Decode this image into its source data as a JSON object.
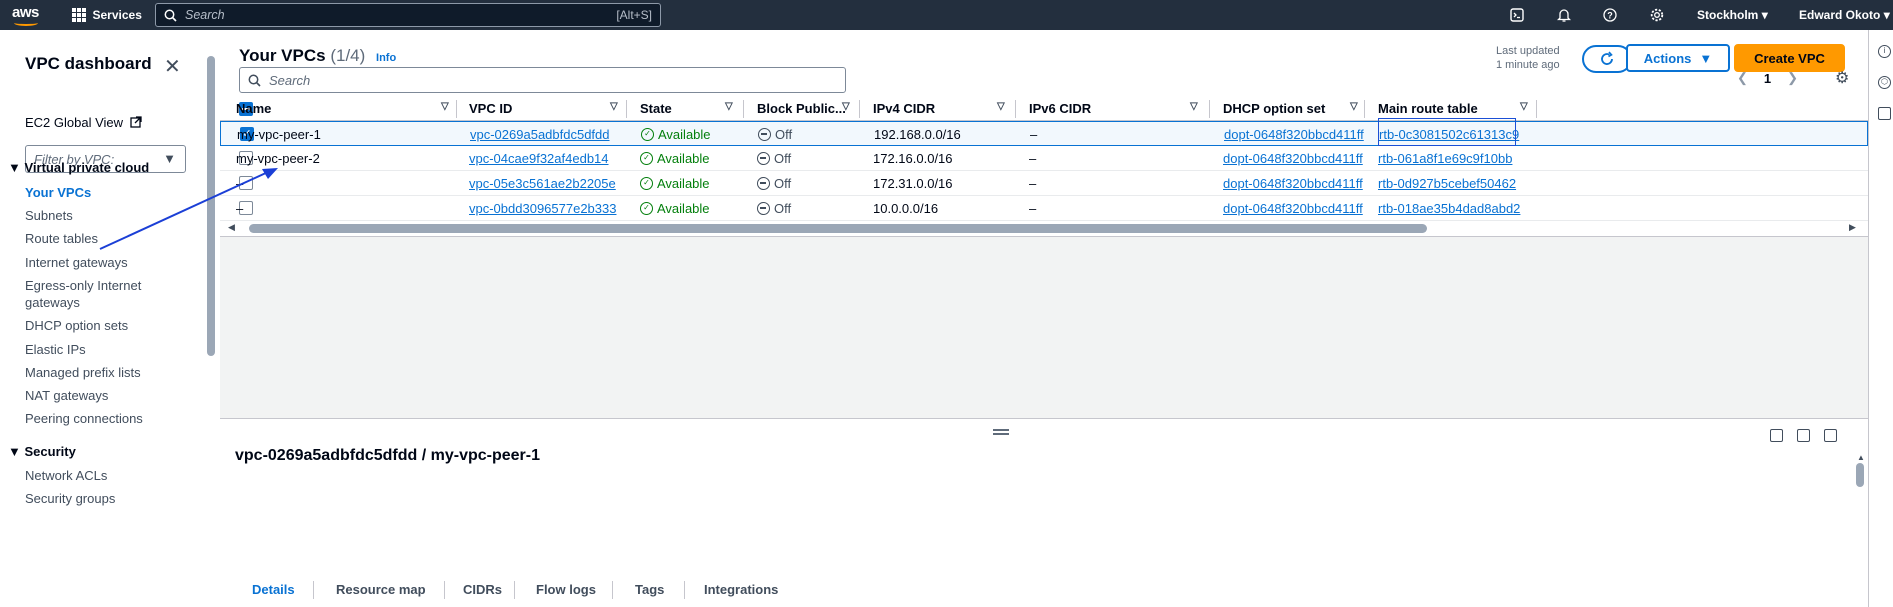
{
  "topnav": {
    "logo": "aws",
    "services": "Services",
    "search_placeholder": "Search",
    "search_shortcut": "[Alt+S]",
    "region": "Stockholm",
    "user": "Edward Okoto",
    "icons": [
      "cloudshell-icon",
      "bell-icon",
      "help-icon",
      "gear-icon"
    ]
  },
  "sidebar": {
    "title": "VPC dashboard",
    "ec2_global_view": "EC2 Global View",
    "filter_placeholder": "Filter by VPC:",
    "section_vpc": "Virtual private cloud",
    "items": [
      "Your VPCs",
      "Subnets",
      "Route tables",
      "Internet gateways",
      "Egress-only Internet",
      "gateways",
      "DHCP option sets",
      "Elastic IPs",
      "Managed prefix lists",
      "NAT gateways",
      "Peering connections"
    ],
    "section_security": "Security",
    "security_items": [
      "Network ACLs",
      "Security groups"
    ]
  },
  "main": {
    "title": "Your VPCs",
    "count": "(1/4)",
    "info": "Info",
    "last_updated_1": "Last updated",
    "last_updated_2": "1 minute ago",
    "actions": "Actions",
    "create": "Create VPC",
    "search_placeholder": "Search",
    "page": "1"
  },
  "table": {
    "headers": [
      "Name",
      "VPC ID",
      "State",
      "Block Public...",
      "IPv4 CIDR",
      "IPv6 CIDR",
      "DHCP option set",
      "Main route table"
    ],
    "rows": [
      {
        "name": "my-vpc-peer-1",
        "vpc_id": "vpc-0269a5adbfdc5dfdd",
        "state": "Available",
        "block": "Off",
        "ipv4": "192.168.0.0/16",
        "ipv6": "–",
        "dhcp": "dopt-0648f320bbcd411ff",
        "rtb": "rtb-0c3081502c61313c9"
      },
      {
        "name": "my-vpc-peer-2",
        "vpc_id": "vpc-04cae9f32af4edb14",
        "state": "Available",
        "block": "Off",
        "ipv4": "172.16.0.0/16",
        "ipv6": "–",
        "dhcp": "dopt-0648f320bbcd411ff",
        "rtb": "rtb-061a8f1e69c9f10bb"
      },
      {
        "name": "–",
        "vpc_id": "vpc-05e3c561ae2b2205e",
        "state": "Available",
        "block": "Off",
        "ipv4": "172.31.0.0/16",
        "ipv6": "–",
        "dhcp": "dopt-0648f320bbcd411ff",
        "rtb": "rtb-0d927b5cebef50462"
      },
      {
        "name": "–",
        "vpc_id": "vpc-0bdd3096577e2b333",
        "state": "Available",
        "block": "Off",
        "ipv4": "10.0.0.0/16",
        "ipv6": "–",
        "dhcp": "dopt-0648f320bbcd411ff",
        "rtb": "rtb-018ae35b4dad8abd2"
      }
    ]
  },
  "split": {
    "title": "vpc-0269a5adbfdc5dfdd / my-vpc-peer-1",
    "tabs": [
      "Details",
      "Resource map",
      "CIDRs",
      "Flow logs",
      "Tags",
      "Integrations"
    ]
  },
  "colors": {
    "nav_bg": "#232f3e",
    "accent": "#0972d3",
    "primary_button": "#ff9900",
    "success": "#037f0c",
    "annotation": "#1b3fd6"
  }
}
